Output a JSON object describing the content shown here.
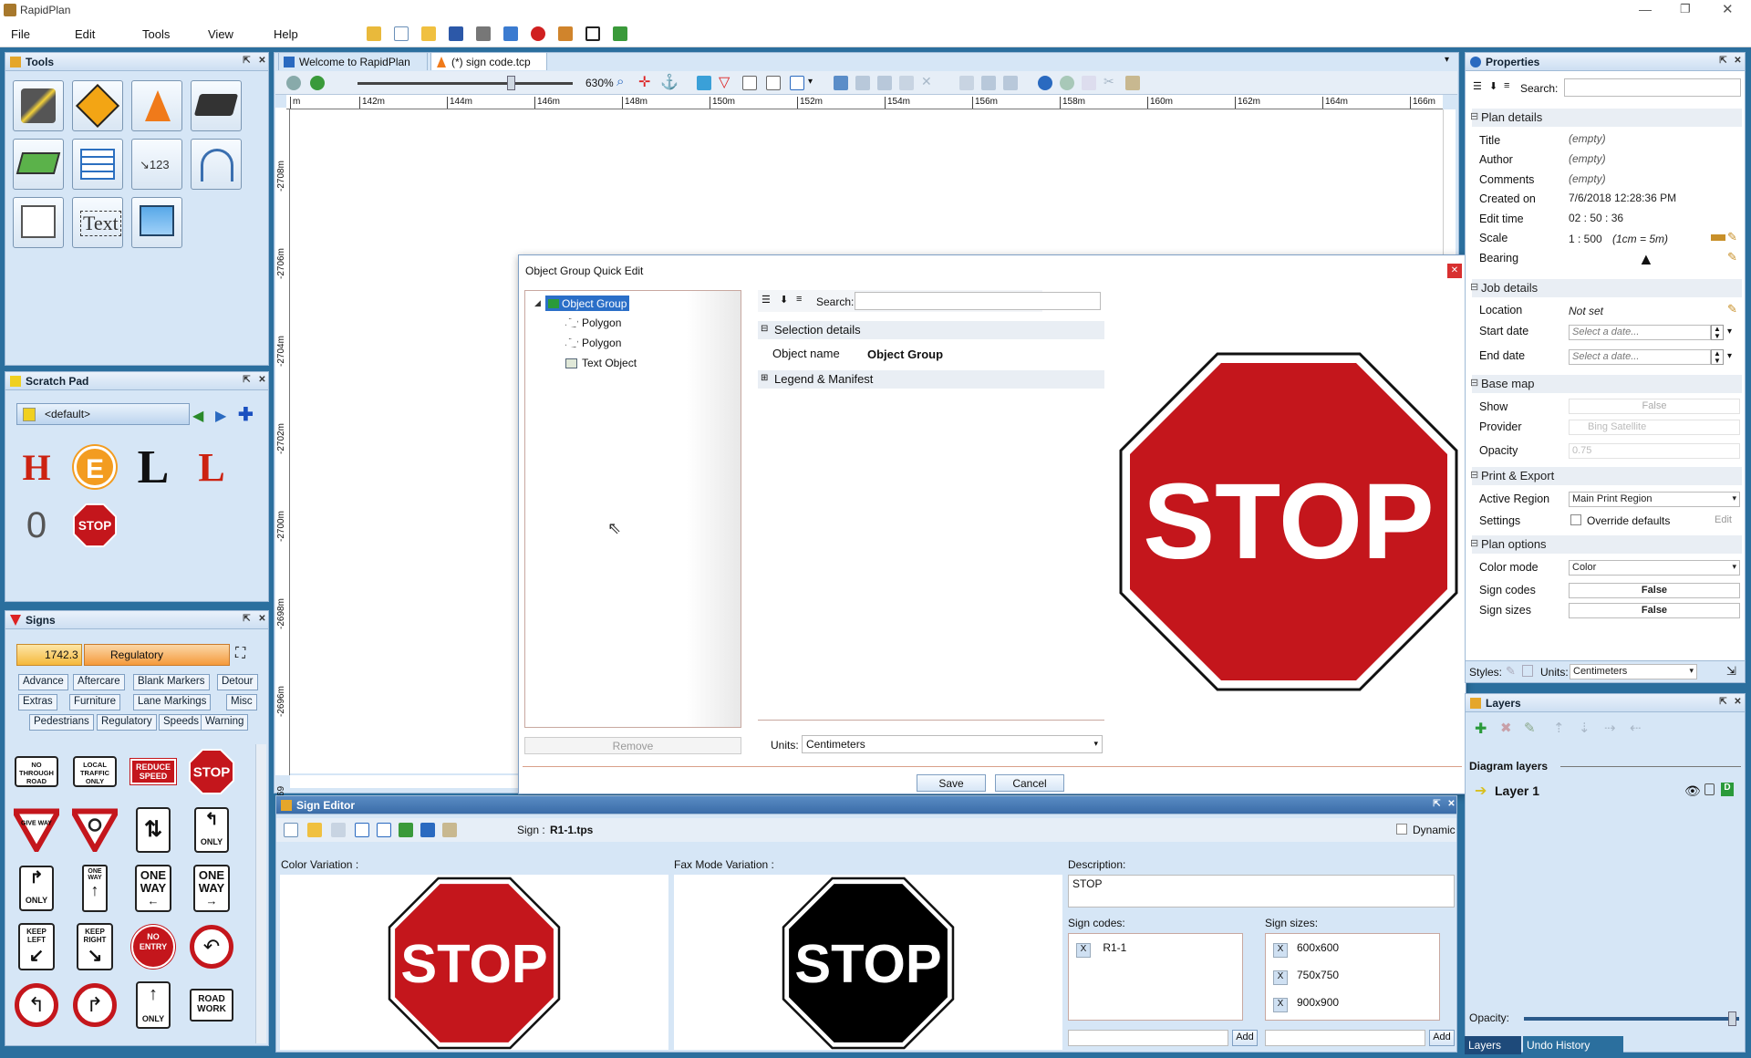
{
  "app": {
    "title": "RapidPlan"
  },
  "menu": [
    "File",
    "Edit",
    "Tools",
    "View",
    "Help"
  ],
  "tools_panel": {
    "title": "Tools",
    "text_tool": "Text"
  },
  "scratch_pad": {
    "title": "Scratch Pad",
    "selector": "<default>"
  },
  "signs_panel": {
    "title": "Signs",
    "standard": "1742.3",
    "category": "Regulatory",
    "tags": [
      "Advance",
      "Aftercare",
      "Blank Markers",
      "Detour",
      "Extras",
      "Furniture",
      "Lane Markings",
      "Misc",
      "Pedestrians",
      "Regulatory",
      "Speeds",
      "Warning"
    ],
    "sign_labels": {
      "no_through_road": "NO THROUGH ROAD",
      "local_traffic_only": "LOCAL TRAFFIC ONLY",
      "reduce_speed": "REDUCE SPEED",
      "stop": "STOP",
      "give_way": "GIVE WAY",
      "only": "ONLY",
      "one_way": "ONE WAY",
      "keep_left": "KEEP LEFT",
      "keep_right": "KEEP RIGHT",
      "no_entry": "NO ENTRY",
      "road_work": "ROAD WORK"
    }
  },
  "tabs": [
    {
      "label": "Welcome to RapidPlan"
    },
    {
      "label": "(*) sign code.tcp"
    }
  ],
  "canvas_toolbar": {
    "zoom": "630%"
  },
  "ruler": {
    "h_ticks": [
      "m",
      "142m",
      "144m",
      "146m",
      "148m",
      "150m",
      "152m",
      "154m",
      "156m",
      "158m",
      "160m",
      "162m",
      "164m",
      "166m"
    ],
    "v_ticks": [
      "-2708m",
      "-2706m",
      "-2704m",
      "-2702m",
      "-2700m",
      "-2698m",
      "-2696m",
      "-269"
    ]
  },
  "dialog": {
    "title": "Object Group Quick Edit",
    "tree": {
      "root": "Object Group",
      "children": [
        "Polygon",
        "Polygon",
        "Text Object"
      ]
    },
    "remove_label": "Remove",
    "search_label": "Search:",
    "selection_details": "Selection details",
    "object_name_label": "Object name",
    "object_name_value": "Object Group",
    "legend_manifest": "Legend & Manifest",
    "units_label": "Units:",
    "units_value": "Centimeters",
    "save_label": "Save",
    "cancel_label": "Cancel",
    "sign_text": "STOP"
  },
  "sign_editor": {
    "title": "Sign Editor",
    "sign_label": "Sign :",
    "sign_file": "R1-1.tps",
    "dynamic_label": "Dynamic",
    "color_variation": "Color Variation :",
    "fax_variation": "Fax Mode Variation :",
    "description_label": "Description:",
    "description_value": "STOP",
    "sign_codes_label": "Sign codes:",
    "sign_codes": [
      "R1-1"
    ],
    "sign_sizes_label": "Sign sizes:",
    "sign_sizes": [
      "600x600",
      "750x750",
      "900x900"
    ],
    "add_label": "Add",
    "remove_x": "X",
    "stop_text": "STOP"
  },
  "properties": {
    "title": "Properties",
    "search_label": "Search:",
    "plan_details": {
      "header": "Plan details",
      "title_label": "Title",
      "title_value": "(empty)",
      "author_label": "Author",
      "author_value": "(empty)",
      "comments_label": "Comments",
      "comments_value": "(empty)",
      "created_label": "Created on",
      "created_value": "7/6/2018 12:28:36 PM",
      "edit_time_label": "Edit time",
      "edit_time_value": "02 : 50 : 36",
      "scale_label": "Scale",
      "scale_value": "1 : 500",
      "scale_note": "(1cm = 5m)",
      "bearing_label": "Bearing"
    },
    "job_details": {
      "header": "Job details",
      "location_label": "Location",
      "location_value": "Not set",
      "start_label": "Start date",
      "start_value": "Select a date...",
      "end_label": "End date",
      "end_value": "Select a date..."
    },
    "base_map": {
      "header": "Base map",
      "show_label": "Show",
      "show_value": "False",
      "provider_label": "Provider",
      "provider_value": "Bing Satellite",
      "opacity_label": "Opacity",
      "opacity_value": "0.75"
    },
    "print_export": {
      "header": "Print & Export",
      "region_label": "Active Region",
      "region_value": "Main Print Region",
      "settings_label": "Settings",
      "override_label": "Override defaults",
      "edit_label": "Edit"
    },
    "plan_options": {
      "header": "Plan options",
      "color_mode_label": "Color mode",
      "color_mode_value": "Color",
      "sign_codes_label": "Sign codes",
      "sign_codes_value": "False",
      "sign_sizes_label": "Sign sizes",
      "sign_sizes_value": "False"
    },
    "styles_label": "Styles:",
    "units_label": "Units:",
    "units_value": "Centimeters"
  },
  "layers": {
    "title": "Layers",
    "diagram_layers": "Diagram layers",
    "layer1": "Layer 1",
    "opacity_label": "Opacity:",
    "opacity_value": 0.97,
    "bottom_tabs": [
      "Layers",
      "Undo History"
    ]
  },
  "colors": {
    "stop_red": "#c4161c",
    "accent": "#2b6f9e",
    "panel_bg": "#d6e6f6"
  }
}
